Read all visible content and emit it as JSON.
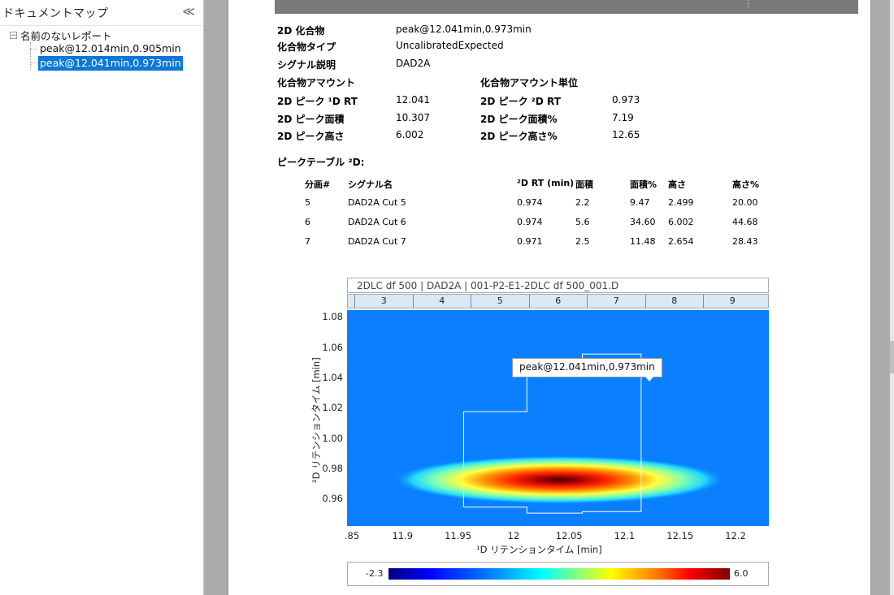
{
  "docmap": {
    "title": "ドキュメントマップ",
    "collapse_icon": "≪",
    "root": "名前のないレポート",
    "items": [
      "peak@12.014min,0.905min",
      "peak@12.041min,0.973min"
    ],
    "selected_index": 1
  },
  "report": {
    "fields": {
      "compound_label": "2D 化合物",
      "compound_value": "peak@12.041min,0.973min",
      "type_label": "化合物タイプ",
      "type_value": "UncalibratedExpected",
      "signal_label": "シグナル説明",
      "signal_value": "DAD2A",
      "amount_label": "化合物アマウント",
      "amount_unit_label": "化合物アマウント単位",
      "rt1_label": "2D ピーク ¹D RT",
      "rt1_value": "12.041",
      "rt2_label": "2D ピーク ²D RT",
      "rt2_value": "0.973",
      "area_label": "2D ピーク面積",
      "area_value": "10.307",
      "areap_label": "2D ピーク面積%",
      "areap_value": "7.19",
      "height_label": "2D ピーク高さ",
      "height_value": "6.002",
      "heightp_label": "2D ピーク高さ%",
      "heightp_value": "12.65"
    },
    "peak_table_title": "ピークテーブル ²D:",
    "peak_table": {
      "headers": [
        "分画#",
        "シグナル名",
        "²D RT (min)",
        "面積",
        "面積%",
        "高さ",
        "高さ%"
      ],
      "rows": [
        [
          "5",
          "DAD2A Cut 5",
          "0.974",
          "2.2",
          "9.47",
          "2.499",
          "20.00"
        ],
        [
          "6",
          "DAD2A Cut 6",
          "0.974",
          "5.6",
          "34.60",
          "6.002",
          "44.68"
        ],
        [
          "7",
          "DAD2A Cut 7",
          "0.971",
          "2.5",
          "11.48",
          "2.654",
          "28.43"
        ]
      ]
    }
  },
  "chart_data": {
    "type": "heatmap",
    "title": "2DLC df 500 | DAD2A | 001-P2-E1-2DLC df 500_001.D",
    "cuts": [
      "3",
      "4",
      "5",
      "6",
      "7",
      "8",
      "9"
    ],
    "xlabel": "¹D リテンションタイム [min]",
    "ylabel": "²D リテンションタイム [min]",
    "xlim": [
      11.85,
      12.23
    ],
    "ylim": [
      0.9425,
      1.085
    ],
    "xticks": [
      11.85,
      11.9,
      11.95,
      12,
      12.05,
      12.1,
      12.15,
      12.2
    ],
    "xtick_labels": [
      ".85",
      "11.9",
      "11.95",
      "12",
      "12.05",
      "12.1",
      "12.15",
      "12.2"
    ],
    "yticks": [
      0.96,
      0.98,
      1.0,
      1.02,
      1.04,
      1.06,
      1.08
    ],
    "ytick_labels": [
      "0.96",
      "0.98",
      "1.00",
      "1.02",
      "1.04",
      "1.06",
      "1.08"
    ],
    "peak_center": [
      12.041,
      0.973
    ],
    "peak_label": "peak@12.041min,0.973min",
    "colorbar": {
      "min": "-2.3",
      "max": "6.0"
    },
    "outline": [
      [
        11.955,
        0.955
      ],
      [
        11.955,
        1.018
      ],
      [
        12.012,
        1.018
      ],
      [
        12.012,
        1.045
      ],
      [
        12.062,
        1.045
      ],
      [
        12.062,
        1.056
      ],
      [
        12.115,
        1.056
      ],
      [
        12.115,
        0.952
      ],
      [
        12.062,
        0.952
      ],
      [
        12.062,
        0.951
      ],
      [
        12.012,
        0.951
      ],
      [
        12.012,
        0.955
      ]
    ]
  }
}
